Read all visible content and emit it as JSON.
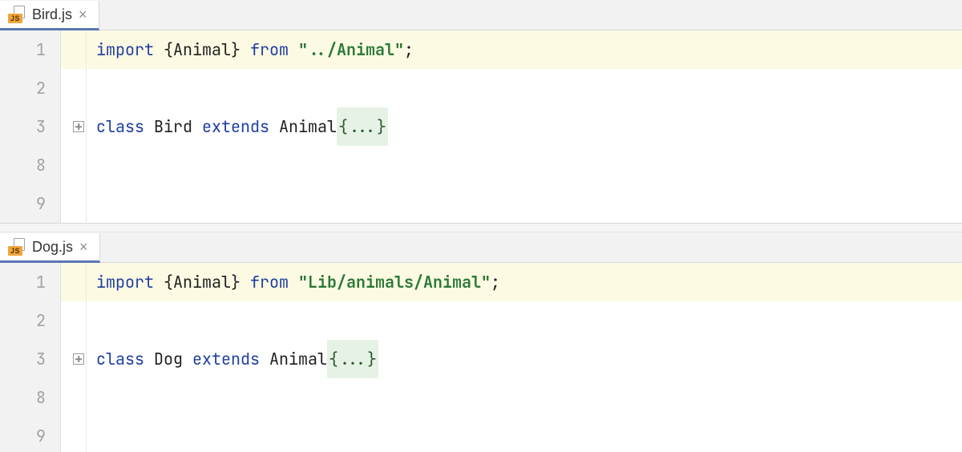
{
  "panes": [
    {
      "file": "Bird.js",
      "icon_badge": "JS",
      "lines": [
        {
          "n": "1",
          "highlight": true,
          "fold": false,
          "tokens": [
            {
              "t": "import ",
              "c": "kw"
            },
            {
              "t": "{",
              "c": "plain"
            },
            {
              "t": "Animal",
              "c": "plain"
            },
            {
              "t": "} ",
              "c": "plain"
            },
            {
              "t": "from ",
              "c": "kw"
            },
            {
              "t": "\"../Animal\"",
              "c": "str-bold"
            },
            {
              "t": ";",
              "c": "plain"
            }
          ]
        },
        {
          "n": "2",
          "highlight": false,
          "fold": false,
          "tokens": []
        },
        {
          "n": "3",
          "highlight": false,
          "fold": true,
          "tokens": [
            {
              "t": "class ",
              "c": "kw"
            },
            {
              "t": "Bird ",
              "c": "plain"
            },
            {
              "t": "extends ",
              "c": "kw"
            },
            {
              "t": "Animal",
              "c": "plain"
            },
            {
              "t": "{...}",
              "c": "fold-ph"
            }
          ]
        },
        {
          "n": "8",
          "highlight": false,
          "fold": false,
          "tokens": []
        },
        {
          "n": "9",
          "highlight": false,
          "fold": false,
          "tokens": []
        }
      ]
    },
    {
      "file": "Dog.js",
      "icon_badge": "JS",
      "lines": [
        {
          "n": "1",
          "highlight": true,
          "fold": false,
          "tokens": [
            {
              "t": "import ",
              "c": "kw"
            },
            {
              "t": "{",
              "c": "plain"
            },
            {
              "t": "Animal",
              "c": "plain"
            },
            {
              "t": "} ",
              "c": "plain"
            },
            {
              "t": "from ",
              "c": "kw"
            },
            {
              "t": "\"Lib/animals/Animal\"",
              "c": "str-bold"
            },
            {
              "t": ";",
              "c": "plain"
            }
          ]
        },
        {
          "n": "2",
          "highlight": false,
          "fold": false,
          "tokens": []
        },
        {
          "n": "3",
          "highlight": false,
          "fold": true,
          "tokens": [
            {
              "t": "class ",
              "c": "kw"
            },
            {
              "t": "Dog ",
              "c": "plain"
            },
            {
              "t": "extends ",
              "c": "kw"
            },
            {
              "t": "Animal",
              "c": "plain"
            },
            {
              "t": "{...}",
              "c": "fold-ph"
            }
          ]
        },
        {
          "n": "8",
          "highlight": false,
          "fold": false,
          "tokens": []
        },
        {
          "n": "9",
          "highlight": false,
          "fold": false,
          "tokens": []
        }
      ]
    }
  ]
}
